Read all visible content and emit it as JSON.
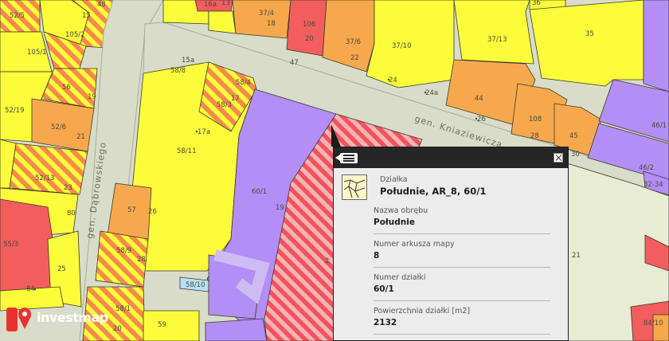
{
  "map": {
    "streets": [
      {
        "id": "kniaziewicza",
        "label": "gen. Kniaziewicza"
      },
      {
        "id": "dabrowskiego",
        "label": "gen. Dąbrowskiego"
      }
    ],
    "parcel_labels": {
      "p1": "52/5",
      "p2": "15",
      "p3": "105/2",
      "p4": "48",
      "p5": "16a",
      "p6": "13",
      "p7": "37/4",
      "p8": "18",
      "p9": "106",
      "p10": "20",
      "p11": "37/6",
      "p12": "22",
      "p13": "37/10",
      "p14": "37/13",
      "p15": "36",
      "p16": "35",
      "p17": "105/1",
      "p18": "56",
      "p19": "19",
      "p20": "52/19",
      "p21": "52/6",
      "p22": "21",
      "p23": "52/13",
      "p24": "23",
      "p25": "15a",
      "p26": "58/8",
      "p27": "47",
      "p28": "58/4",
      "p29": "58/3",
      "p30": "17",
      "p31": "24",
      "p32": "24a",
      "p33": "44",
      "p34": "26",
      "p35": "108",
      "p36": "28",
      "p37": "45",
      "p38": "30",
      "p39": "46/1",
      "p40": "46/2",
      "p41": "32-34",
      "p42": "17a",
      "p43": "58/11",
      "p44": "60/1",
      "p45": "19",
      "p46": "80",
      "p47": "57",
      "p48": "26",
      "p49": "55/3",
      "p50": "58/9",
      "p51": "28",
      "p52": "25",
      "p53": "58/10",
      "p54": "84",
      "p55": "58/1",
      "p56": "59",
      "p57": "2",
      "p58": "20",
      "p59": "84/10",
      "p60": "21"
    },
    "colors": {
      "yellow": "#fcfc3a",
      "orange": "#f7a84c",
      "red": "#f35d5e",
      "purple": "#b28ef6",
      "road": "#d9dcc8",
      "road_edge": "#a7ab98",
      "hatch_red": "#f1525c",
      "hatch_light": "#f7b3b3"
    }
  },
  "popup": {
    "type_label": "Działka",
    "type_value": "Południe, AR_8, 60/1",
    "fields": [
      {
        "label": "Nazwa obrębu",
        "value": "Południe"
      },
      {
        "label": "Numer arkusza mapy",
        "value": "8"
      },
      {
        "label": "Numer działki",
        "value": "60/1"
      },
      {
        "label": "Powierzchnia działki [m2]",
        "value": "2132"
      }
    ]
  },
  "brand": {
    "name": "investmap",
    "color": "#e8322f"
  }
}
